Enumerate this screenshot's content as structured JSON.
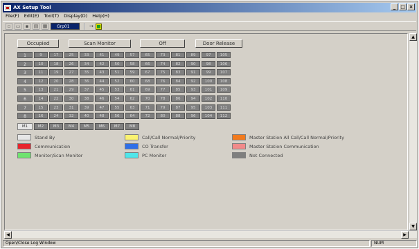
{
  "window": {
    "title": "AX Setup Tool"
  },
  "menu": [
    "File(F)",
    "Edit(E)",
    "Tool(T)",
    "Display(D)",
    "Help(H)"
  ],
  "toolbar": {
    "selector_value": "Grp01"
  },
  "top_buttons": [
    "Occupied",
    "Scan Monitor",
    "Off",
    "Door Release"
  ],
  "grid": {
    "rows": [
      {
        "label": "1",
        "cells": [
          "9",
          "17",
          "25",
          "33",
          "41",
          "49",
          "57",
          "65",
          "73",
          "81",
          "89",
          "97",
          "105"
        ]
      },
      {
        "label": "2",
        "cells": [
          "10",
          "18",
          "26",
          "34",
          "42",
          "50",
          "58",
          "66",
          "74",
          "82",
          "90",
          "98",
          "106"
        ]
      },
      {
        "label": "3",
        "cells": [
          "11",
          "19",
          "27",
          "35",
          "43",
          "51",
          "59",
          "67",
          "75",
          "83",
          "91",
          "99",
          "107"
        ]
      },
      {
        "label": "4",
        "cells": [
          "12",
          "20",
          "28",
          "36",
          "44",
          "52",
          "60",
          "68",
          "76",
          "84",
          "92",
          "100",
          "108"
        ]
      },
      {
        "label": "5",
        "cells": [
          "13",
          "21",
          "29",
          "37",
          "45",
          "53",
          "61",
          "69",
          "77",
          "85",
          "93",
          "101",
          "109"
        ]
      },
      {
        "label": "6",
        "cells": [
          "14",
          "22",
          "30",
          "38",
          "46",
          "54",
          "62",
          "70",
          "78",
          "86",
          "94",
          "102",
          "110"
        ]
      },
      {
        "label": "7",
        "cells": [
          "15",
          "23",
          "31",
          "39",
          "47",
          "55",
          "63",
          "71",
          "79",
          "87",
          "95",
          "103",
          "111"
        ]
      },
      {
        "label": "8",
        "cells": [
          "16",
          "24",
          "32",
          "40",
          "48",
          "56",
          "64",
          "72",
          "80",
          "88",
          "96",
          "104",
          "112"
        ]
      }
    ],
    "master_row": [
      "M1",
      "M2",
      "M3",
      "M4",
      "M5",
      "M6",
      "M7",
      "M8"
    ]
  },
  "legend": [
    {
      "label": "Stand By",
      "color": "#e6e6e6"
    },
    {
      "label": "Communication",
      "color": "#e8242b"
    },
    {
      "label": "Monitor/Scan Monitor",
      "color": "#6fe36f"
    },
    {
      "label": "Call/Call Normal/Priority",
      "color": "#fbf271"
    },
    {
      "label": "CO Transfer",
      "color": "#2f6fe8"
    },
    {
      "label": "PC Monitor",
      "color": "#4fe6ea"
    },
    {
      "label": "Master Station All Call/Call Normal/Priority",
      "color": "#f27a1d"
    },
    {
      "label": "Master Station Communication",
      "color": "#f18a8a"
    },
    {
      "label": "Not Connected",
      "color": "#7f7f7f"
    }
  ],
  "status": {
    "left": "Open/Close Log Window",
    "right": "NUM"
  }
}
